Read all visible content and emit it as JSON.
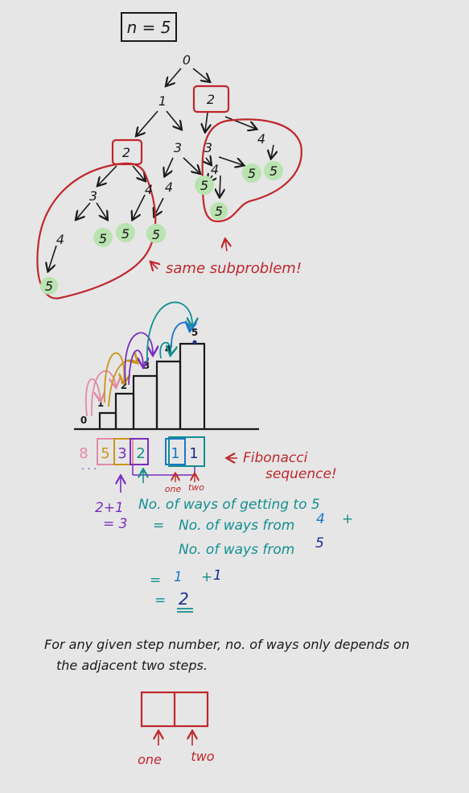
{
  "header": {
    "n_label": "n = 5"
  },
  "tree": {
    "nodes": [
      "0",
      "1",
      "2",
      "2",
      "3",
      "3",
      "4",
      "3",
      "4",
      "4",
      "4",
      "5",
      "5",
      "5",
      "5",
      "5",
      "5",
      "5",
      "5",
      "5",
      "4",
      "5"
    ],
    "note": "same subproblem!"
  },
  "stairs": {
    "step_labels": [
      "0",
      "1",
      "2",
      "3",
      "4",
      "5"
    ]
  },
  "sequence": {
    "values": [
      "8",
      "5",
      "3",
      "2",
      "1",
      "1"
    ],
    "dots": ". . .",
    "note_line1": "Fibonacci",
    "note_line2": "sequence!",
    "one_label": "one",
    "two_label": "two"
  },
  "calc": {
    "left_line1": "2+1",
    "left_line2": "= 3",
    "line1": "No. of ways of getting to 5",
    "line2_eq": "=",
    "line2_pre": "No. of ways from",
    "line2_num": "4",
    "line2_plus": "+",
    "line3_pre": "No. of ways from",
    "line3_num": "5",
    "line4_eq": "=",
    "line4_a": "1",
    "line4_plus": "+",
    "line4_b": "1",
    "line5_eq": "=",
    "line5_val": "2"
  },
  "footer": {
    "line1": "For any given step number, no. of ways only depends on",
    "line2": "the adjacent two steps.",
    "one_label": "one",
    "two_label": "two"
  },
  "colors": {
    "background": "#e6e6e6",
    "ink": "#1a1a1a",
    "red": "#c0272d",
    "green_highlight": "#b9e3b0",
    "pink": "#e48aa4",
    "orange": "#c9961a",
    "purple": "#7b2fbf",
    "blue": "#1877c9",
    "teal": "#138f8f",
    "navy": "#1b2f8c"
  }
}
